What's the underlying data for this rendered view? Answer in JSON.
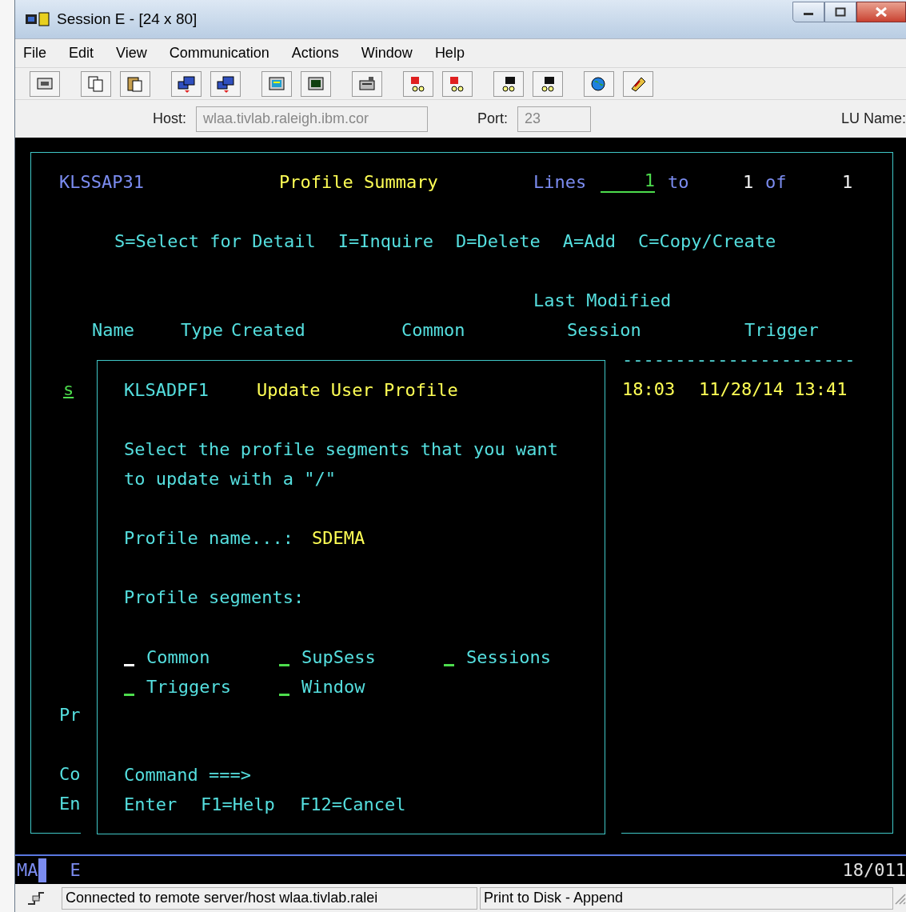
{
  "window": {
    "title": "Session E - [24 x 80]"
  },
  "menu": [
    "File",
    "Edit",
    "View",
    "Communication",
    "Actions",
    "Window",
    "Help"
  ],
  "connection": {
    "host_label": "Host:",
    "host_value": "wlaa.tivlab.raleigh.ibm.cor",
    "port_label": "Port:",
    "port_value": "23",
    "lu_label": "LU Name:"
  },
  "screen": {
    "panel_id": "KLSSAP31",
    "title": "Profile Summary",
    "lines_label": "Lines",
    "lines_from": "1",
    "to_label": "to",
    "lines_shown": "1",
    "of_label": "of",
    "lines_total": "1",
    "actions": [
      "S=Select for Detail",
      "I=Inquire",
      "D=Delete",
      "A=Add",
      "C=Copy/Create"
    ],
    "column_group": "Last Modified",
    "columns": [
      "Name",
      "Type",
      "Created",
      "Common",
      "Session",
      "Trigger"
    ],
    "separator": "----------------------",
    "row": {
      "select": "s",
      "column_5": "18:03",
      "column_6": "11/28/14 13:41"
    },
    "left_fragments": [
      "Pr",
      "Co",
      "En"
    ]
  },
  "dialog": {
    "panel_id": "KLSADPF1",
    "title": "Update User Profile",
    "instructions": [
      "Select the profile segments that you want",
      "to update with a \"/\""
    ],
    "profile_label": "Profile name...:",
    "profile_value": "SDEMA",
    "segments_label": "Profile segments:",
    "segments": [
      {
        "label": "Common",
        "focused": true
      },
      {
        "label": "SupSess",
        "focused": false
      },
      {
        "label": "Sessions",
        "focused": false
      },
      {
        "label": "Triggers",
        "focused": false
      },
      {
        "label": "Window",
        "focused": false
      }
    ],
    "command_label": "Command ===>",
    "keys": [
      "Enter",
      "F1=Help",
      "F12=Cancel"
    ]
  },
  "oia": {
    "mode": "MA",
    "session": "E",
    "position": "18/011"
  },
  "status_bar": [
    "Connected to remote server/host wlaa.tivlab.ralei",
    "Print to Disk - Append"
  ]
}
